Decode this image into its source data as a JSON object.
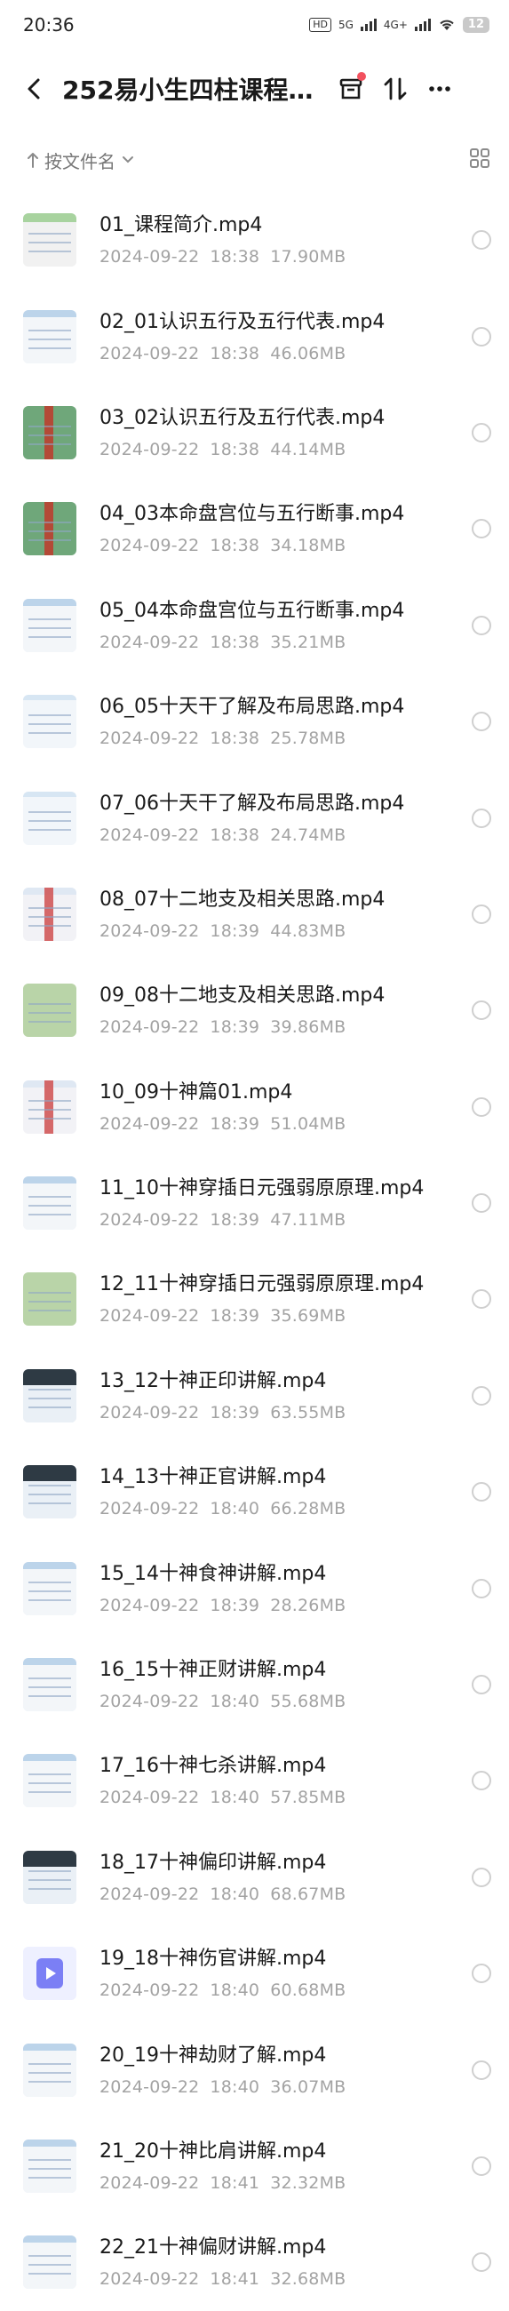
{
  "status": {
    "time": "20:36",
    "hd": "HD",
    "net5g": "5G",
    "net4g": "4G+",
    "battery": "12"
  },
  "header": {
    "title": "252易小生四柱课程…"
  },
  "sort": {
    "label": "按文件名"
  },
  "files": [
    {
      "name": "01_课程简介.mp4",
      "date": "2024-09-22",
      "time": "18:38",
      "size": "17.90MB",
      "thumb": "green"
    },
    {
      "name": "02_01认识五行及五行代表.mp4",
      "date": "2024-09-22",
      "time": "18:38",
      "size": "46.06MB",
      "thumb": "blue"
    },
    {
      "name": "03_02认识五行及五行代表.mp4",
      "date": "2024-09-22",
      "time": "18:38",
      "size": "44.14MB",
      "thumb": "table"
    },
    {
      "name": "04_03本命盘宫位与五行断事.mp4",
      "date": "2024-09-22",
      "time": "18:38",
      "size": "34.18MB",
      "thumb": "table"
    },
    {
      "name": "05_04本命盘宫位与五行断事.mp4",
      "date": "2024-09-22",
      "time": "18:38",
      "size": "35.21MB",
      "thumb": "blue"
    },
    {
      "name": "06_05十天干了解及布局思路.mp4",
      "date": "2024-09-22",
      "time": "18:38",
      "size": "25.78MB",
      "thumb": "light"
    },
    {
      "name": "07_06十天干了解及布局思路.mp4",
      "date": "2024-09-22",
      "time": "18:38",
      "size": "24.74MB",
      "thumb": "light"
    },
    {
      "name": "08_07十二地支及相关思路.mp4",
      "date": "2024-09-22",
      "time": "18:39",
      "size": "44.83MB",
      "thumb": "red"
    },
    {
      "name": "09_08十二地支及相关思路.mp4",
      "date": "2024-09-22",
      "time": "18:39",
      "size": "39.86MB",
      "thumb": "chart"
    },
    {
      "name": "10_09十神篇01.mp4",
      "date": "2024-09-22",
      "time": "18:39",
      "size": "51.04MB",
      "thumb": "red"
    },
    {
      "name": "11_10十神穿插日元强弱原原理.mp4",
      "date": "2024-09-22",
      "time": "18:39",
      "size": "47.11MB",
      "thumb": "blue"
    },
    {
      "name": "12_11十神穿插日元强弱原原理.mp4",
      "date": "2024-09-22",
      "time": "18:39",
      "size": "35.69MB",
      "thumb": "chart"
    },
    {
      "name": "13_12十神正印讲解.mp4",
      "date": "2024-09-22",
      "time": "18:39",
      "size": "63.55MB",
      "thumb": "dark"
    },
    {
      "name": "14_13十神正官讲解.mp4",
      "date": "2024-09-22",
      "time": "18:40",
      "size": "66.28MB",
      "thumb": "dark"
    },
    {
      "name": "15_14十神食神讲解.mp4",
      "date": "2024-09-22",
      "time": "18:39",
      "size": "28.26MB",
      "thumb": "blue"
    },
    {
      "name": "16_15十神正财讲解.mp4",
      "date": "2024-09-22",
      "time": "18:40",
      "size": "55.68MB",
      "thumb": "blue"
    },
    {
      "name": "17_16十神七杀讲解.mp4",
      "date": "2024-09-22",
      "time": "18:40",
      "size": "57.85MB",
      "thumb": "blue"
    },
    {
      "name": "18_17十神偏印讲解.mp4",
      "date": "2024-09-22",
      "time": "18:40",
      "size": "68.67MB",
      "thumb": "dark"
    },
    {
      "name": "19_18十神伤官讲解.mp4",
      "date": "2024-09-22",
      "time": "18:40",
      "size": "60.68MB",
      "thumb": "video"
    },
    {
      "name": "20_19十神劫财了解.mp4",
      "date": "2024-09-22",
      "time": "18:40",
      "size": "36.07MB",
      "thumb": "blue"
    },
    {
      "name": "21_20十神比肩讲解.mp4",
      "date": "2024-09-22",
      "time": "18:41",
      "size": "32.32MB",
      "thumb": "blue"
    },
    {
      "name": "22_21十神偏财讲解.mp4",
      "date": "2024-09-22",
      "time": "18:41",
      "size": "32.68MB",
      "thumb": "blue"
    }
  ],
  "colors": {
    "accent_dot": "#f2515e",
    "meta_gray": "#a3a3a3",
    "video_icon": "#7b7ff5"
  }
}
